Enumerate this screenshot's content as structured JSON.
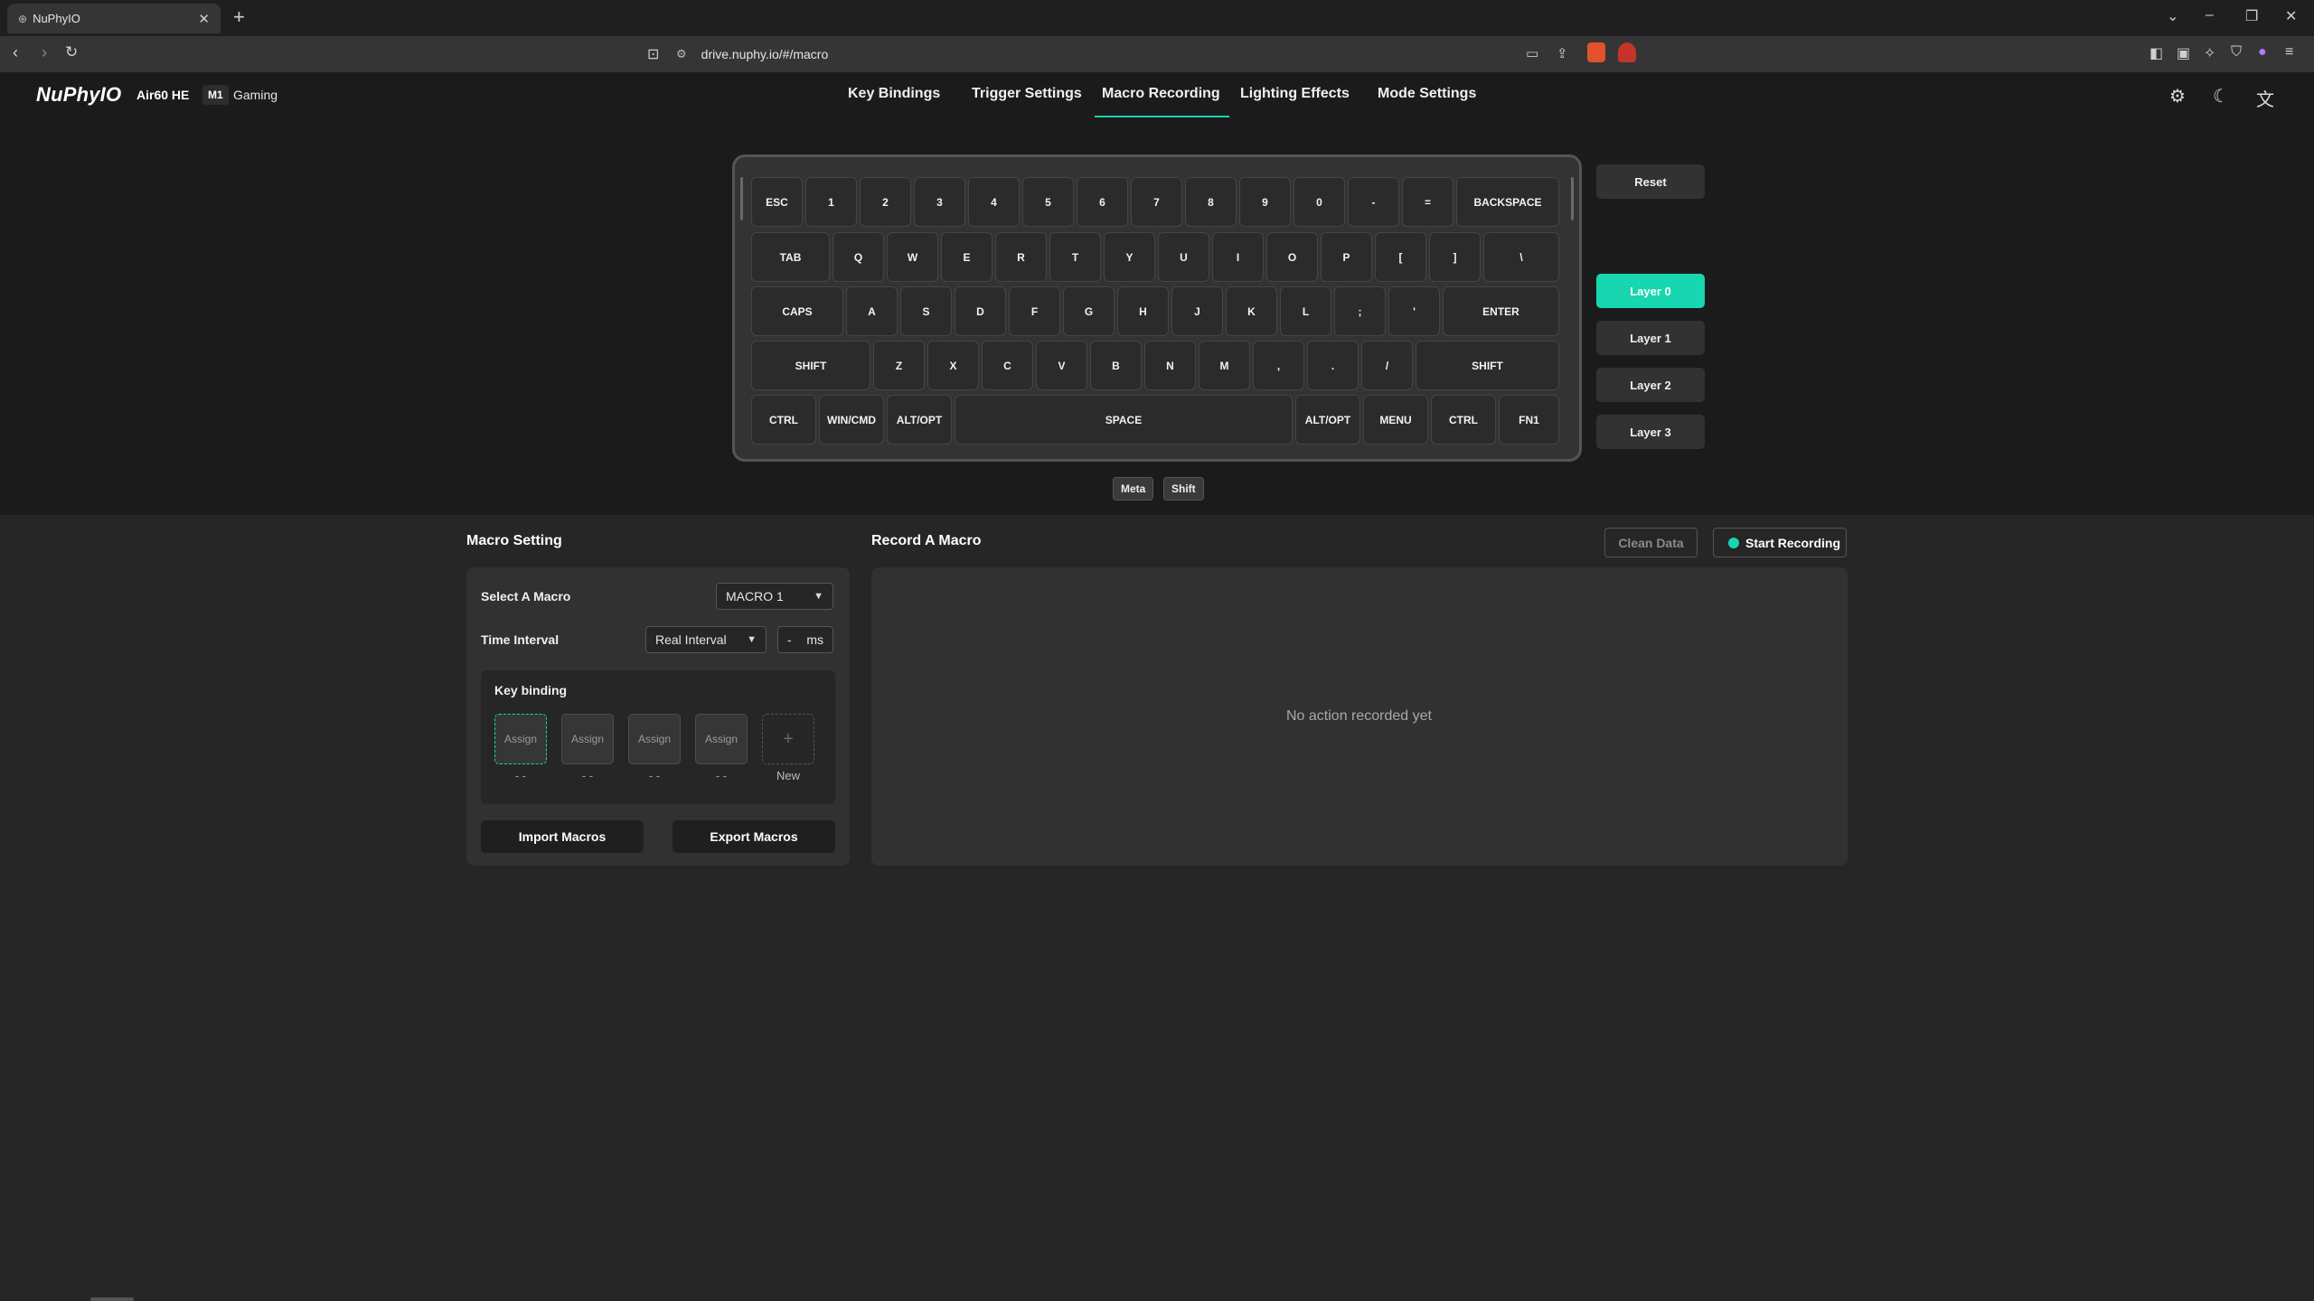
{
  "browser": {
    "tab_title": "NuPhyIO",
    "url": "drive.nuphy.io/#/macro"
  },
  "app": {
    "logo": "NuPhyIO",
    "device": "Air60 HE",
    "mode_badge": "M1",
    "mode_name": "Gaming",
    "nav": [
      "Key Bindings",
      "Trigger Settings",
      "Macro Recording",
      "Lighting Effects",
      "Mode Settings"
    ],
    "active_nav": "Macro Recording"
  },
  "keyboard": {
    "rows": [
      [
        "ESC",
        "1",
        "2",
        "3",
        "4",
        "5",
        "6",
        "7",
        "8",
        "9",
        "0",
        "-",
        "=",
        "BACKSPACE"
      ],
      [
        "TAB",
        "Q",
        "W",
        "E",
        "R",
        "T",
        "Y",
        "U",
        "I",
        "O",
        "P",
        "[",
        "]",
        "\\"
      ],
      [
        "CAPS",
        "A",
        "S",
        "D",
        "F",
        "G",
        "H",
        "J",
        "K",
        "L",
        ";",
        "'",
        "ENTER"
      ],
      [
        "SHIFT",
        "Z",
        "X",
        "C",
        "V",
        "B",
        "N",
        "M",
        ",",
        ".",
        "/",
        "SHIFT"
      ],
      [
        "CTRL",
        "WIN/CMD",
        "ALT/OPT",
        "SPACE",
        "ALT/OPT",
        "MENU",
        "CTRL",
        "FN1"
      ]
    ],
    "modifiers": [
      "Meta",
      "Shift"
    ]
  },
  "side": {
    "reset": "Reset",
    "layers": [
      "Layer 0",
      "Layer 1",
      "Layer 2",
      "Layer 3"
    ],
    "active_layer": "Layer 0"
  },
  "macro_setting": {
    "title": "Macro Setting",
    "select_label": "Select A Macro",
    "select_value": "MACRO 1",
    "interval_label": "Time Interval",
    "interval_value": "Real Interval",
    "interval_ms": "-",
    "ms_unit": "ms",
    "key_binding_title": "Key binding",
    "slots": [
      {
        "label": "Assign",
        "caption": "- -"
      },
      {
        "label": "Assign",
        "caption": "- -"
      },
      {
        "label": "Assign",
        "caption": "- -"
      },
      {
        "label": "Assign",
        "caption": "- -"
      }
    ],
    "new_symbol": "+",
    "new_caption": "New",
    "import": "Import Macros",
    "export": "Export Macros"
  },
  "record": {
    "title": "Record A Macro",
    "clean": "Clean Data",
    "start": "Start Recording",
    "empty": "No action recorded yet"
  },
  "colors": {
    "accent": "#17d6b0"
  }
}
